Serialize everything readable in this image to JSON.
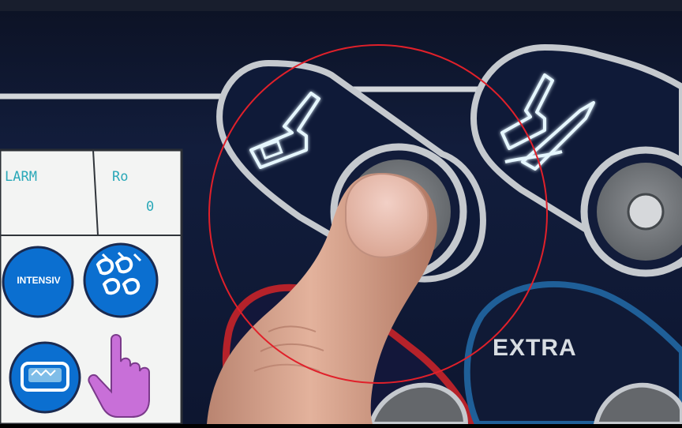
{
  "lcd": {
    "cell_left_text": "LARM",
    "cell_right_text": "Ro",
    "cell_right_value": "0",
    "intensive_label": "INTENSIV"
  },
  "panel": {
    "extra_label": "EXTRA"
  },
  "icons": {
    "lcd_intensive": "intensive-program-icon",
    "lcd_drops": "water-drops-icon",
    "lcd_tray": "wash-tray-icon",
    "lcd_hand": "touch-hand-icon",
    "btn1": "dental-handpiece-icon",
    "btn2": "handpiece-with-tool-icon"
  },
  "colors": {
    "panel_dark": "#101a36",
    "glow_cyan": "#dff6ff",
    "lcd_blue": "#0b6fd0",
    "annotation_red": "#e0202a",
    "extra_ring_blue": "#1f5f98",
    "hand_purple": "#c86fd8"
  }
}
